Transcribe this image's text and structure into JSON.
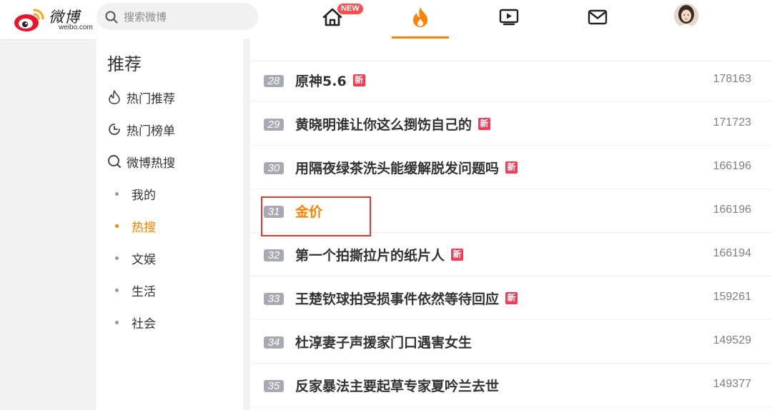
{
  "header": {
    "logo_text": "微博",
    "logo_sub": "weibo.com",
    "search_placeholder": "搜索微博",
    "nav": {
      "home_badge": "NEW"
    },
    "colors": {
      "accent": "#ff8200",
      "badge": "#ff4d4f"
    }
  },
  "sidebar": {
    "title": "推荐",
    "items": [
      {
        "label": "热门推荐",
        "icon": "flame-outline-icon"
      },
      {
        "label": "热门榜单",
        "icon": "chart-circle-icon"
      },
      {
        "label": "微博热搜",
        "icon": "search-circle-icon"
      },
      {
        "label": "我的",
        "icon": "dot"
      },
      {
        "label": "热搜",
        "icon": "dot",
        "active": true
      },
      {
        "label": "文娱",
        "icon": "dot"
      },
      {
        "label": "生活",
        "icon": "dot"
      },
      {
        "label": "社会",
        "icon": "dot"
      }
    ]
  },
  "hot_list": [
    {
      "rank": "28",
      "title": "原神5.6",
      "new_badge": "新",
      "count": "178163"
    },
    {
      "rank": "29",
      "title": "黄晓明谁让你这么捯饬自己的",
      "new_badge": "新",
      "count": "171723"
    },
    {
      "rank": "30",
      "title": "用隔夜绿茶洗头能缓解脱发问题吗",
      "new_badge": "新",
      "count": "166196"
    },
    {
      "rank": "31",
      "title": "金价",
      "new_badge": "",
      "count": "166196",
      "highlighted": true
    },
    {
      "rank": "32",
      "title": "第一个拍撕拉片的纸片人",
      "new_badge": "新",
      "count": "166194"
    },
    {
      "rank": "33",
      "title": "王楚钦球拍受损事件依然等待回应",
      "new_badge": "新",
      "count": "159261"
    },
    {
      "rank": "34",
      "title": "杜淳妻子声援家门口遇害女生",
      "new_badge": "",
      "count": "149529"
    },
    {
      "rank": "35",
      "title": "反家暴法主要起草专家夏吟兰去世",
      "new_badge": "",
      "count": "149377"
    }
  ]
}
